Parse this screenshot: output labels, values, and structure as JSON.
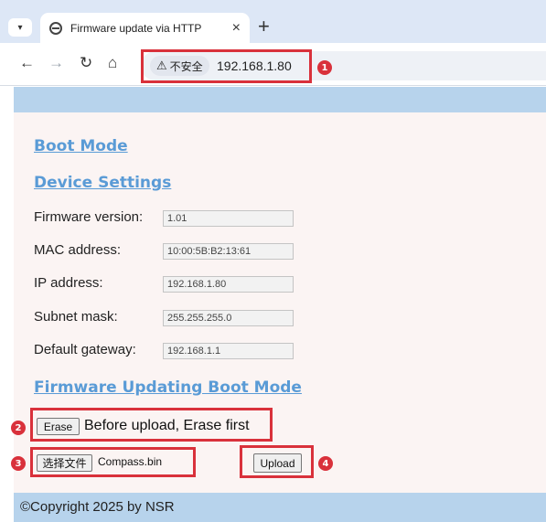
{
  "browser": {
    "tab_title": "Firmware update via HTTP",
    "tab_close": "×",
    "new_tab": "+",
    "tab_menu_icon": "▾",
    "back_icon": "←",
    "forward_icon": "→",
    "reload_icon": "↻",
    "home_icon": "⌂",
    "security_warning_icon": "⚠",
    "security_label": "不安全",
    "url": "192.168.1.80"
  },
  "page": {
    "boot_mode_link": "Boot Mode",
    "device_settings_link": "Device Settings",
    "fields": [
      {
        "label": "Firmware version:",
        "value": "1.01"
      },
      {
        "label": "MAC address:",
        "value": "10:00:5B:B2:13:61"
      },
      {
        "label": "IP address:",
        "value": "192.168.1.80"
      },
      {
        "label": "Subnet mask:",
        "value": "255.255.255.0"
      },
      {
        "label": "Default gateway:",
        "value": "192.168.1.1"
      }
    ],
    "firmware_boot_mode_link": "Firmware Updating Boot Mode",
    "erase_button": "Erase",
    "erase_note": "Before upload, Erase first",
    "choose_file_button": "选择文件",
    "file_name": "Compass.bin",
    "upload_button": "Upload",
    "footer": "©Copyright 2025 by NSR"
  },
  "annotations": {
    "markers": [
      "1",
      "2",
      "3",
      "4"
    ],
    "color": "#d9313b"
  },
  "colors": {
    "link": "#5a9bd6",
    "band": "#b7d3ec",
    "content_bg": "#fbf4f3",
    "chrome_bg": "#dde7f6"
  }
}
